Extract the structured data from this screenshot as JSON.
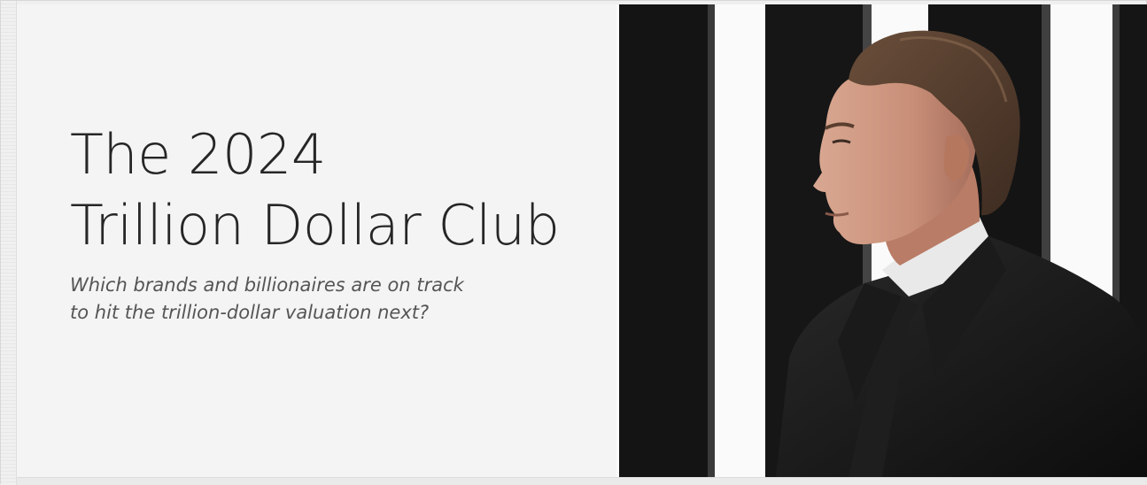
{
  "banner": {
    "title_line1": "The 2024",
    "title_line2": "Trillion Dollar Club",
    "subtitle_line1": "Which brands and billionaires are on track",
    "subtitle_line2": "to hit the trillion-dollar valuation next?"
  },
  "colors": {
    "background": "#f4f4f4",
    "title_text": "#262626",
    "subtitle_text": "#555555",
    "stripe_dark": "#141414",
    "stripe_light": "#fafafa"
  }
}
